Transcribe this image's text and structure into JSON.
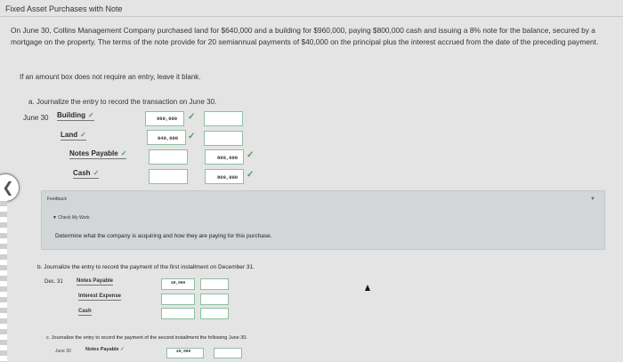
{
  "header": {
    "title": "Fixed Asset Purchases with Note"
  },
  "problem_text": "On June 30, Collins Management Company purchased land for $640,000 and a building for $960,000, paying $800,000 cash and issuing a 8% note for the balance, secured by a mortgage on the property. The terms of the note provide for 20 semiannual payments of $40,000 on the principal plus the interest accrued from the date of the preceding payment.",
  "instruction": "If an amount box does not require an entry, leave it blank.",
  "part_a": {
    "label": "a. Journalize the entry to record the transaction on June 30.",
    "date": "June 30",
    "rows": [
      {
        "account": "Building",
        "debit": "960,000",
        "credit": ""
      },
      {
        "account": "Land",
        "debit": "640,000",
        "credit": ""
      },
      {
        "account": "Notes Payable",
        "debit": "",
        "credit": "800,000"
      },
      {
        "account": "Cash",
        "debit": "",
        "credit": "800,000"
      }
    ],
    "check_mark": "✓"
  },
  "feedback": {
    "label": "Feedback",
    "check_my_work": "Check My Work",
    "hint": "Determine what the company is acquiring and how they are paying for this purchase."
  },
  "part_b": {
    "label": "b. Journalize the entry to record the payment of the first installment on December 31.",
    "date": "Dec. 31",
    "rows": [
      {
        "account": "Notes Payable",
        "debit": "40,000",
        "credit": ""
      },
      {
        "account": "Interest Expense",
        "debit": "",
        "credit": ""
      },
      {
        "account": "Cash",
        "debit": "",
        "credit": ""
      }
    ]
  },
  "part_c": {
    "label": "c. Journalize the entry to record the payment of the second installment the following June 30.",
    "date": "June 30",
    "account": "Notes Payable",
    "debit": "40,000"
  },
  "icons": {
    "nav_left": "chevron-left-icon",
    "check": "checkmark-icon"
  },
  "colors": {
    "check_green": "#48a35a",
    "box_border": "#8dbfa3",
    "feedback_bg": "#d2d6d9"
  }
}
